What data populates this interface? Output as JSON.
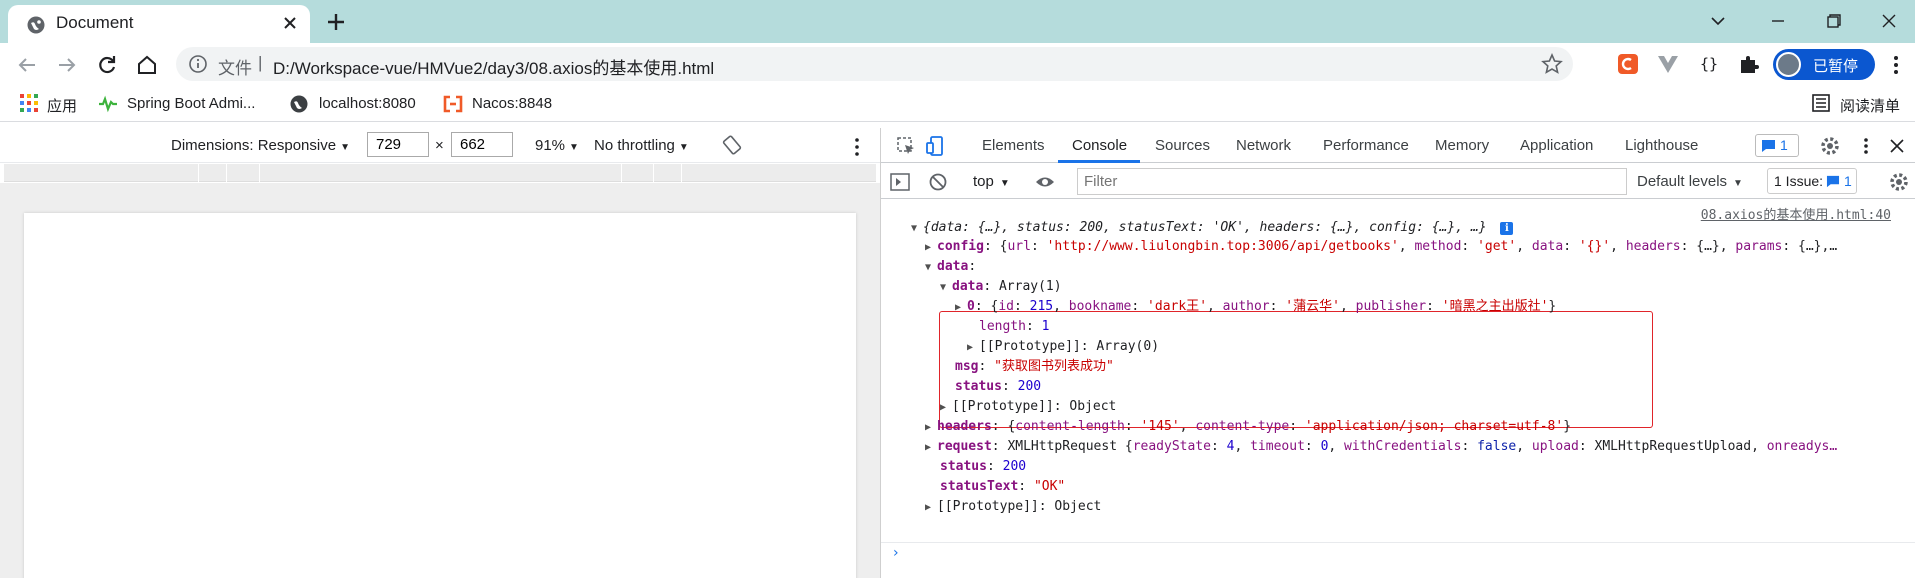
{
  "browser": {
    "tab_title": "Document",
    "omnibox": {
      "file_label": "文件",
      "separator": "|",
      "url": "D:/Workspace-vue/HMVue2/day3/08.axios的基本使用.html"
    },
    "profile_label": "已暂停",
    "bookmarks": [
      "应用",
      "Spring Boot Admi...",
      "localhost:8080",
      "Nacos:8848"
    ],
    "reading_list": "阅读清单"
  },
  "device_toolbar": {
    "dimensions_label": "Dimensions: Responsive",
    "width_value": "729",
    "times": "×",
    "height_value": "662",
    "zoom": "91%",
    "throttling": "No throttling"
  },
  "devtools": {
    "tabs": [
      "Elements",
      "Console",
      "Sources",
      "Network",
      "Performance",
      "Memory",
      "Application",
      "Lighthouse"
    ],
    "active_tab": "Console",
    "message_badge_count": "1",
    "context": "top",
    "filter_placeholder": "Filter",
    "levels": "Default levels",
    "issues_label": "1 Issue:",
    "issues_count": "1"
  },
  "console": {
    "source_link": "08.axios的基本使用.html:40",
    "response_summary": "{data: {…}, status: 200, statusText: 'OK', headers: {…}, config: {…}, …}",
    "config": {
      "key": "config",
      "url": "http://www.liulongbin.top:3006/api/getbooks",
      "method": "get",
      "data": "{}"
    },
    "data_key": "data",
    "inner_data": {
      "key": "data",
      "type": "Array(1)",
      "item_index": "0",
      "id": "215",
      "bookname": "dark王",
      "author": "蒲云华",
      "publisher": "暗黑之主出版社",
      "length": "1",
      "prototype": "Array(0)"
    },
    "msg": "\"获取图书列表成功\"",
    "inner_status": "200",
    "data_prototype": "Object",
    "headers": {
      "content_length": "145",
      "content_type": "application/json; charset=utf-8"
    },
    "request": {
      "type": "XMLHttpRequest",
      "ready_state": "4",
      "timeout": "0",
      "with_credentials": "false",
      "upload": "XMLHttpRequestUpload"
    },
    "status": "200",
    "status_text": "\"OK\"",
    "root_prototype": "Object"
  },
  "colors": {
    "tabstrip_bg": "#b5dcdc",
    "accent": "#1a73e8",
    "highlight_box": "#e0242a",
    "profile_chip": "#0b57d0"
  }
}
